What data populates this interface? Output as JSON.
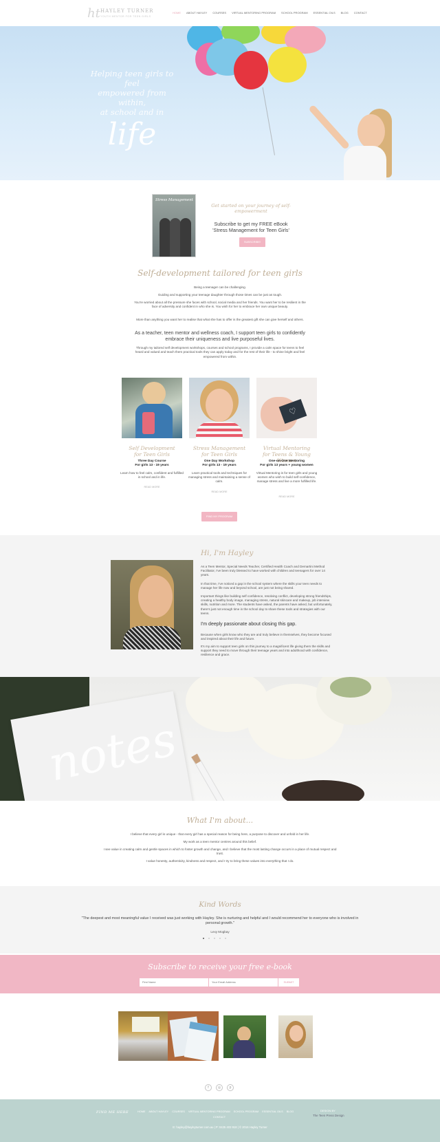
{
  "header": {
    "logo_mark": "ht",
    "logo_name": "HAYLEY TURNER",
    "logo_tagline": "YOUTH MENTOR FOR TEEN GIRLS",
    "nav": [
      "HOME",
      "ABOUT HAYLEY",
      "COURSES",
      "VIRTUAL MENTORING PROGRAM",
      "SCHOOL PROGRAM",
      "ESSENTIAL OILS",
      "BLOG",
      "CONTACT"
    ]
  },
  "hero": {
    "lines": [
      "Helping teen girls to feel",
      "empowered from within,",
      "at school and in"
    ],
    "word": "life"
  },
  "ebook": {
    "cover_title": "Stress Management",
    "intro": "Get started on your journey of self-empowerment",
    "subtitle": "Subscribe to get my FREE eBook 'Stress Management for Teen Girls'",
    "button": "SUBSCRIBE!"
  },
  "intro": {
    "title": "Self-development tailored for teen girls",
    "p1": "Being a teenager can be challenging.",
    "p2": "Guiding and supporting your teenage daughter through those times can be just as tough.",
    "p3": "You're worried about all the pressure she faces with school, social media and her friends. You want her to be resilient in the face of adversity and confident in who she is. You wish for her to embrace her own unique beauty.",
    "p4": "More than anything you want her to realise that what she has to offer is the greatest gift she can give herself and others.",
    "p5": "As a teacher, teen mentor and wellness coach, I support teen girls to confidently embrace their uniqueness and live purposeful lives.",
    "p6": "Through my tailored self development workshops, courses and school programs, I provide a calm space for teens to feel heard and valued and teach them practical tools they can apply today and for the rest of their life - to shine bright and feel empowered from within."
  },
  "programs": [
    {
      "title_1": "Self Development",
      "title_2": "for Teen Girls",
      "sub_1": "Three Day Course",
      "sub_2": "For girls 13 - 19 years",
      "desc": "Learn how to feel calm, confident and fulfilled in school and in life.",
      "link": "READ MORE"
    },
    {
      "title_1": "Stress Management",
      "title_2": "for Teen Girls",
      "sub_1": "One Day Workshop",
      "sub_2": "For girls 13 - 19 years",
      "desc": "Learn practical tools and techniques for managing stress and maintaining a sense of calm.",
      "link": "READ MORE"
    },
    {
      "title_1": "Virtual Mentoring",
      "title_2": "for Teens & Young Women",
      "sub_1": "One-on-One Mentoring",
      "sub_2": "For girls 13 years + young women",
      "desc": "Virtual Mentoring is for teen girls and young women who wish to build self-confidence, manage stress and live a more fulfilled life.",
      "link": "READ MORE"
    }
  ],
  "programs_button": "FIND MY PROGRAM",
  "about": {
    "title": "Hi, I'm Hayley",
    "p1": "As a Teen Mentor, Special Needs Teacher, Certified Health Coach and Demartini Method Facilitator, I've been truly blessed to have worked with children and teenagers for over 14 years.",
    "p2": "In that time, I've noticed a gap in the school system where the skills your teen needs to manage her life now and beyond school, are just not being shared.",
    "p3": "Important things like building self confidence, resolving conflict, developing strong friendships, creating a healthy body image, managing stress, natural skincare and makeup, job interview skills, nutrition and more. The students have asked, the parents have asked, but unfortunately, there's just not enough time in the school day to share these tools and strategies with our teens.",
    "p4": "I'm deeply passionate about closing this gap.",
    "p5": "Because when girls know who they are and truly believe in themselves, they become focused and inspired about their life and future.",
    "p6": "It's my aim to support teen girls on this journey to a magnificent life giving them the skills and support they need to move through their teenage years and into adulthood with confidence, resilience and grace."
  },
  "notes_word": "notes",
  "values": {
    "title": "What I'm about...",
    "p1": "I believe that every girl is unique - that every girl has a special reason for being here, a purpose to discover and unfold in her life.",
    "p2": "My work as a teen mentor centres around this belief.",
    "p3": "I see value in creating calm and gentle spaces in which to foster growth and change, and I believe that the most lasting change occurs in a place of mutual respect and trust.",
    "p4": "I value honesty, authenticity, kindness and respect, and I try to bring these values into everything that I do."
  },
  "testimonial": {
    "title": "Kind Words",
    "quote": "\"The deepest and most meaningful value I received was just working with Hayley. She is nurturing and helpful and I would recommend her to everyone who is involved in personal growth.\"",
    "author": "Lexy Mogbay"
  },
  "subscribe": {
    "title": "Subscribe to receive your free e-book",
    "first_name_placeholder": "First Name",
    "email_placeholder": "Your Email Address",
    "button": "SUBMIT"
  },
  "footer": {
    "find_me": "FIND ME HERE",
    "nav": [
      "HOME",
      "ABOUT HAYLEY",
      "COURSES",
      "VIRTUAL MENTORING PROGRAM",
      "SCHOOL PROGRAM",
      "ESSENTIAL OILS",
      "BLOG"
    ],
    "contact": "CONTACT",
    "design_label": "DESIGN BY",
    "design_name": "The Teen Press Design",
    "copyright": "E: hayley@hayleyturner.com.au | P: 0425 403 918 | © 2016 Hayley Turner"
  },
  "colors": {
    "accent_pink": "#f1b7c5",
    "heading_gold": "#c6b39a",
    "footer_teal": "#bcd3cf"
  }
}
